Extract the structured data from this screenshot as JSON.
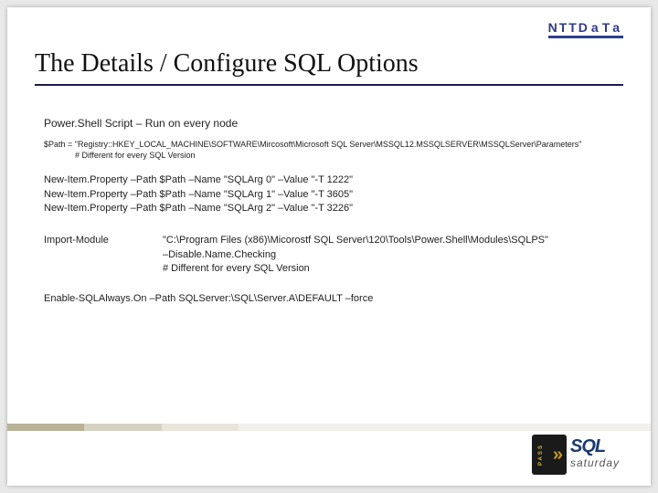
{
  "brand": {
    "ntt": "NTT",
    "data": "DaTa"
  },
  "title": "The Details / Configure SQL Options",
  "script_label": "Power.Shell Script – Run on every node",
  "path_line": "$Path = \"Registry::HKEY_LOCAL_MACHINE\\SOFTWARE\\Mircosoft\\Microsoft SQL Server\\MSSQL12.MSSQLSERVER\\MSSQLServer\\Parameters\"",
  "path_note": "# Different for every SQL Version",
  "newprops": [
    "New-Item.Property –Path $Path –Name \"SQLArg 0\" –Value \"-T 1222\"",
    "New-Item.Property –Path $Path –Name \"SQLArg 1\" –Value \"-T 3605\"",
    "New-Item.Property –Path $Path –Name \"SQLArg 2\" –Value \"-T 3226\""
  ],
  "import_module": {
    "label": "Import-Module",
    "line1": "\"C:\\Program Files (x86)\\Micorostf SQL Server\\120\\Tools\\Power.Shell\\Modules\\SQLPS\"",
    "line2": "–Disable.Name.Checking",
    "line3": "# Different for every SQL Version"
  },
  "enable_line": "Enable-SQLAlways.On –Path SQLServer:\\SQL\\Server.A\\DEFAULT –force",
  "sql_logo": {
    "pass": "PASS",
    "sql": "SQL",
    "saturday": "saturday"
  }
}
